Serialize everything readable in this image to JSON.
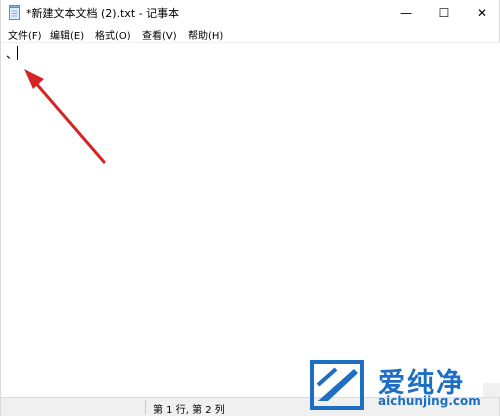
{
  "window": {
    "title": "*新建文本文档 (2).txt - 记事本",
    "minimize_glyph": "—",
    "maximize_glyph": "☐",
    "close_glyph": "✕"
  },
  "menu": {
    "items": [
      {
        "label": "文件(F)"
      },
      {
        "label": "编辑(E)"
      },
      {
        "label": "格式(O)"
      },
      {
        "label": "查看(V)"
      },
      {
        "label": "帮助(H)"
      }
    ]
  },
  "editor": {
    "content": "、"
  },
  "status": {
    "position": "第 1 行, 第 2 列"
  },
  "watermark": {
    "text_cn": "爱纯净",
    "text_en": "aichunjing.com"
  },
  "icons": {
    "app": "notepad-icon",
    "annotation": "red-arrow-icon",
    "watermark_logo": "watermark-logo-icon"
  },
  "colors": {
    "arrow": "#d62424",
    "watermark": "#1e6fc4"
  }
}
